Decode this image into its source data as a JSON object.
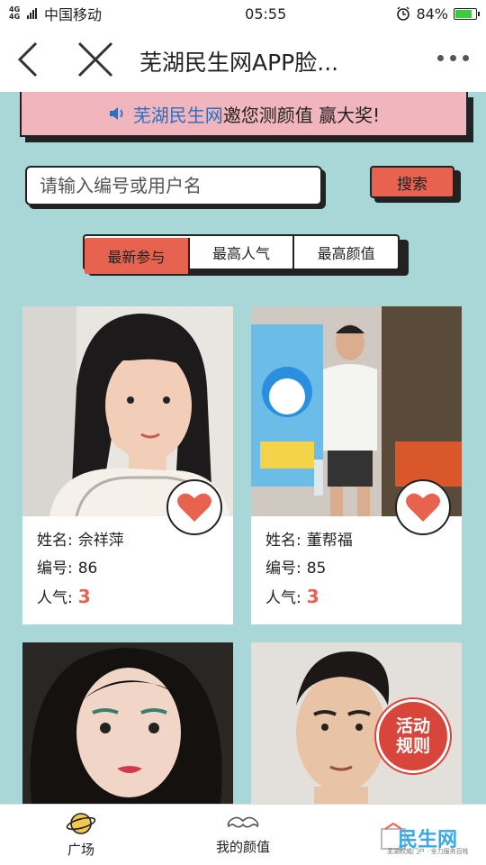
{
  "status_bar": {
    "network": "4G 4G",
    "carrier": "中国移动",
    "time": "05:55",
    "battery": "84%",
    "battery_level": 0.84
  },
  "nav": {
    "title": "芜湖民生网APP脸..."
  },
  "banner": {
    "brand": "芜湖民生网",
    "text": " 邀您测颜值 赢大奖!"
  },
  "search": {
    "placeholder": "请输入编号或用户名",
    "button_label": "搜索"
  },
  "tabs": [
    {
      "label": "最新参与",
      "active": true
    },
    {
      "label": "最高人气",
      "active": false
    },
    {
      "label": "最高颜值",
      "active": false
    }
  ],
  "cards": [
    {
      "name_label": "姓名:",
      "name": "佘祥萍",
      "id_label": "编号:",
      "id": "86",
      "pop_label": "人气:",
      "popularity": "3"
    },
    {
      "name_label": "姓名:",
      "name": "董帮福",
      "id_label": "编号:",
      "id": "85",
      "pop_label": "人气:",
      "popularity": "3"
    }
  ],
  "rules_badge": {
    "line1": "活动",
    "line2": "规则"
  },
  "tabbar": [
    {
      "label": "广场",
      "icon": "planet-icon"
    },
    {
      "label": "我的颜值",
      "icon": "mustache-icon"
    }
  ],
  "watermark": {
    "brand": "民生网",
    "sub": "芜湖权威门户 · 全力服务百姓"
  },
  "colors": {
    "background": "#a9d6d6",
    "accent": "#e8634f",
    "banner": "#f0b5bd",
    "brand_blue": "#2c6fbf"
  }
}
